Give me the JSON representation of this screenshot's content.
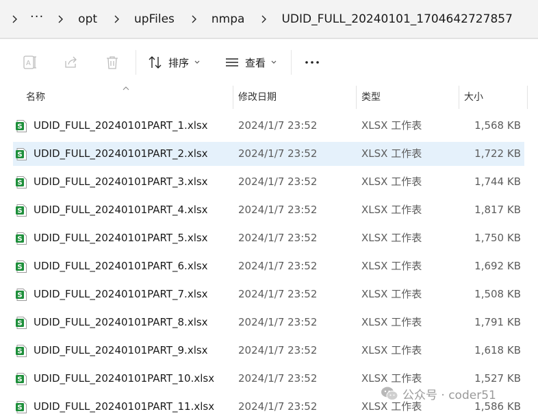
{
  "breadcrumb": {
    "items": [
      "opt",
      "upFiles",
      "nmpa",
      "UDID_FULL_20240101_1704642727857"
    ]
  },
  "toolbar": {
    "sort_label": "排序",
    "view_label": "查看"
  },
  "columns": {
    "name": "名称",
    "date": "修改日期",
    "type": "类型",
    "size": "大小"
  },
  "files": [
    {
      "name": "UDID_FULL_20240101PART_1.xlsx",
      "date": "2024/1/7 23:52",
      "type": "XLSX 工作表",
      "size": "1,568 KB"
    },
    {
      "name": "UDID_FULL_20240101PART_2.xlsx",
      "date": "2024/1/7 23:52",
      "type": "XLSX 工作表",
      "size": "1,722 KB"
    },
    {
      "name": "UDID_FULL_20240101PART_3.xlsx",
      "date": "2024/1/7 23:52",
      "type": "XLSX 工作表",
      "size": "1,744 KB"
    },
    {
      "name": "UDID_FULL_20240101PART_4.xlsx",
      "date": "2024/1/7 23:52",
      "type": "XLSX 工作表",
      "size": "1,817 KB"
    },
    {
      "name": "UDID_FULL_20240101PART_5.xlsx",
      "date": "2024/1/7 23:52",
      "type": "XLSX 工作表",
      "size": "1,750 KB"
    },
    {
      "name": "UDID_FULL_20240101PART_6.xlsx",
      "date": "2024/1/7 23:52",
      "type": "XLSX 工作表",
      "size": "1,692 KB"
    },
    {
      "name": "UDID_FULL_20240101PART_7.xlsx",
      "date": "2024/1/7 23:52",
      "type": "XLSX 工作表",
      "size": "1,508 KB"
    },
    {
      "name": "UDID_FULL_20240101PART_8.xlsx",
      "date": "2024/1/7 23:52",
      "type": "XLSX 工作表",
      "size": "1,791 KB"
    },
    {
      "name": "UDID_FULL_20240101PART_9.xlsx",
      "date": "2024/1/7 23:52",
      "type": "XLSX 工作表",
      "size": "1,618 KB"
    },
    {
      "name": "UDID_FULL_20240101PART_10.xlsx",
      "date": "2024/1/7 23:52",
      "type": "XLSX 工作表",
      "size": "1,527 KB"
    },
    {
      "name": "UDID_FULL_20240101PART_11.xlsx",
      "date": "2024/1/7 23:52",
      "type": "XLSX 工作表",
      "size": "1,586 KB"
    }
  ],
  "watermark": {
    "text": "公众号 · coder51"
  },
  "colors": {
    "selected_row": "#e5f1fb",
    "excel_green": "#1e8f3b"
  }
}
